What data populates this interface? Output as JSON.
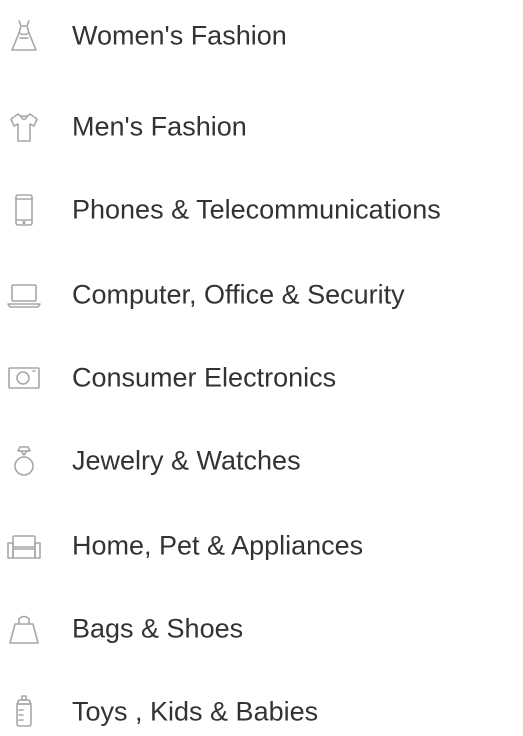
{
  "categories": [
    {
      "label": "Women's Fashion",
      "icon": "dress-icon"
    },
    {
      "label": "Men's Fashion",
      "icon": "shirt-icon"
    },
    {
      "label": "Phones & Telecommunications",
      "icon": "phone-icon"
    },
    {
      "label": "Computer, Office & Security",
      "icon": "laptop-icon"
    },
    {
      "label": "Consumer Electronics",
      "icon": "camera-icon"
    },
    {
      "label": "Jewelry & Watches",
      "icon": "ring-icon"
    },
    {
      "label": "Home, Pet & Appliances",
      "icon": "sofa-icon"
    },
    {
      "label": "Bags & Shoes",
      "icon": "bag-icon"
    },
    {
      "label": "Toys , Kids & Babies",
      "icon": "baby-bottle-icon"
    }
  ],
  "colors": {
    "text": "#333333",
    "icon": "#a7a7a7",
    "background": "#ffffff"
  }
}
